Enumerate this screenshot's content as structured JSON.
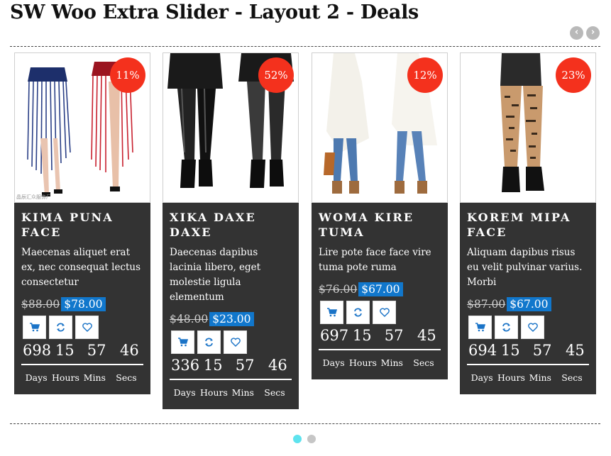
{
  "page": {
    "title": "SW Woo Extra Slider - Layout 2 - Deals"
  },
  "nav": {
    "prev_icon": "chevron-left-icon",
    "prev_label": "‹",
    "next_icon": "chevron-right-icon",
    "next_label": "›"
  },
  "colors": {
    "card_bg": "#333333",
    "discount_bg": "#f4311d",
    "price_bg": "#1177cc",
    "dot_active": "#5ee3ee",
    "dot_inactive": "#c6c6c6"
  },
  "action_icons": [
    "cart-icon",
    "compare-icon",
    "wishlist-heart-icon"
  ],
  "units": [
    "Days",
    "Hours",
    "Mins",
    "Secs"
  ],
  "products": [
    {
      "discount": "11%",
      "name": "Kima Puna Face",
      "description": "Maecenas aliquet erat ex, nec consequat lectus consectetur",
      "old_price": "$88.00",
      "new_price": "$78.00",
      "countdown": [
        "698",
        "15",
        "57",
        "46"
      ]
    },
    {
      "discount": "52%",
      "name": "Xika Daxe Daxe",
      "description": "Daecenas dapibus lacinia libero, eget molestie ligula elementum",
      "old_price": "$48.00",
      "new_price": "$23.00",
      "countdown": [
        "336",
        "15",
        "57",
        "46"
      ]
    },
    {
      "discount": "12%",
      "name": "Woma Kire Tuma",
      "description": "Lire pote face face vire tuma pote ruma",
      "old_price": "$76.00",
      "new_price": "$67.00",
      "countdown": [
        "697",
        "15",
        "57",
        "45"
      ]
    },
    {
      "discount": "23%",
      "name": "Korem Mipa Face",
      "description": "Aliquam dapibus risus eu velit pulvinar varius. Morbi",
      "old_price": "$87.00",
      "new_price": "$67.00",
      "countdown": [
        "694",
        "15",
        "57",
        "45"
      ]
    }
  ],
  "pagination": {
    "total": 2,
    "active_index": 0
  }
}
